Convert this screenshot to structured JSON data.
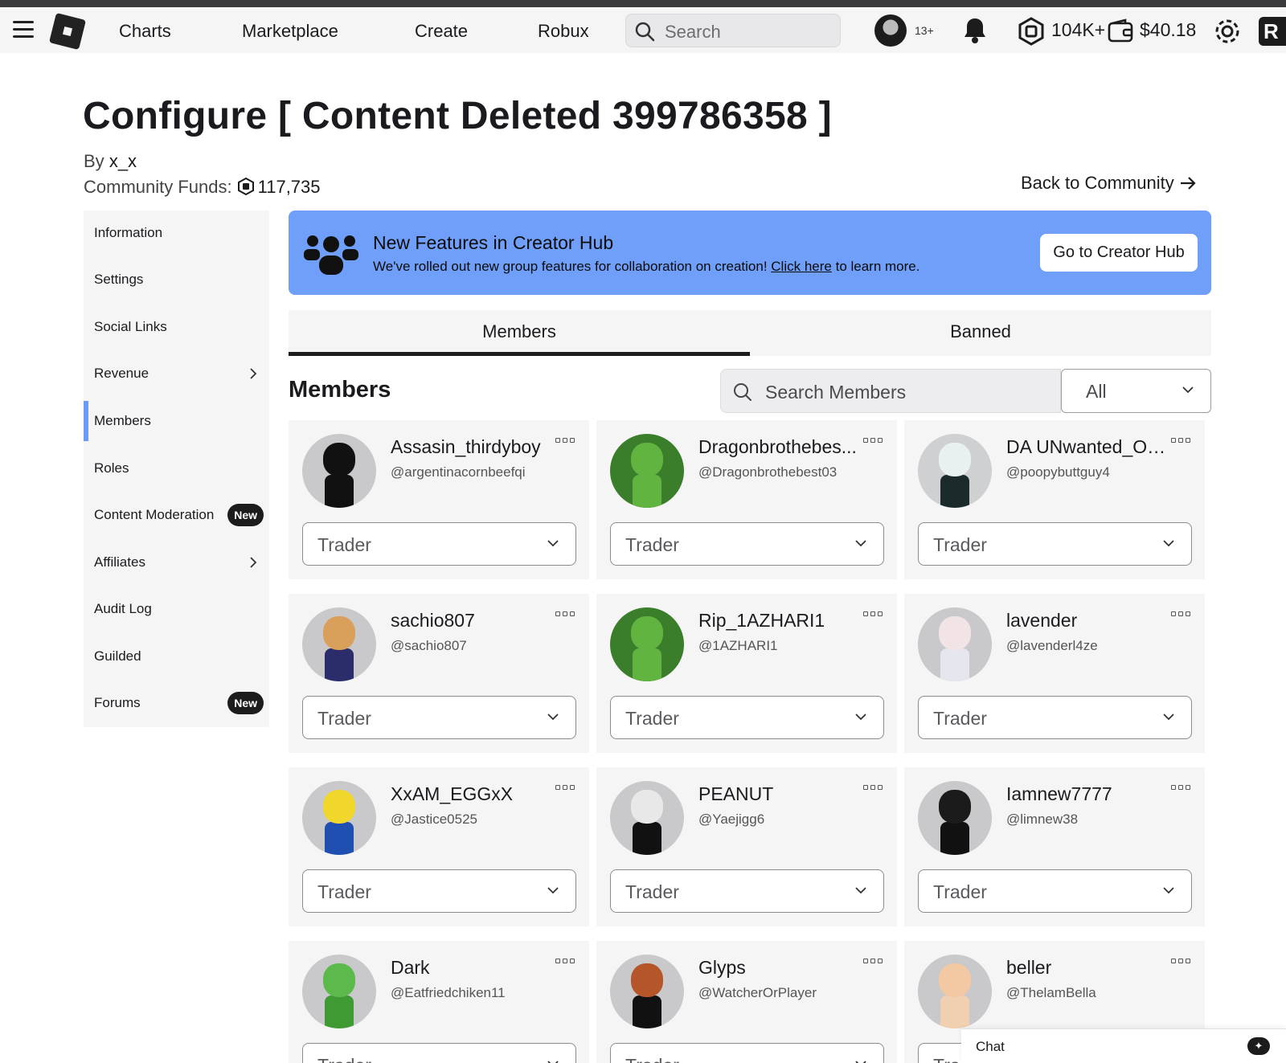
{
  "topnav": {
    "links": [
      "Charts",
      "Marketplace",
      "Create",
      "Robux"
    ],
    "search_placeholder": "Search",
    "age_badge": "13+",
    "robux_balance": "104K+",
    "wallet_balance": "$40.18",
    "partial_icon_letter": "R"
  },
  "header": {
    "title": "Configure [ Content Deleted 399786358 ]",
    "by_label": "By",
    "owner": "x_x",
    "funds_label": "Community Funds:",
    "funds_amount": "117,735",
    "back_link": "Back to Community"
  },
  "sidebar": {
    "items": [
      {
        "label": "Information"
      },
      {
        "label": "Settings"
      },
      {
        "label": "Social Links"
      },
      {
        "label": "Revenue"
      },
      {
        "label": "Members"
      },
      {
        "label": "Roles"
      },
      {
        "label": "Content Moderation",
        "badge": "New"
      },
      {
        "label": "Affiliates"
      },
      {
        "label": "Audit Log"
      },
      {
        "label": "Guilded"
      },
      {
        "label": "Forums",
        "badge": "New"
      }
    ],
    "active": "Members"
  },
  "banner": {
    "title": "New Features in Creator Hub",
    "desc_before": "We've rolled out new group features for collaboration on creation! ",
    "desc_link": "Click here",
    "desc_after": " to learn more.",
    "button": "Go to Creator Hub"
  },
  "tabs": [
    {
      "label": "Members",
      "active": true
    },
    {
      "label": "Banned",
      "active": false
    }
  ],
  "members": {
    "heading": "Members",
    "search_placeholder": "Search Members",
    "filter_value": "All",
    "cards": [
      {
        "name": "Assasin_thirdyboy",
        "handle": "@argentinacornbeefqi",
        "role": "Trader"
      },
      {
        "name": "Dragonbrothebes...",
        "handle": "@Dragonbrothebest03",
        "role": "Trader"
      },
      {
        "name": "DA UNwanted_One",
        "handle": "@poopybuttguy4",
        "role": "Trader"
      },
      {
        "name": "sachio807",
        "handle": "@sachio807",
        "role": "Trader"
      },
      {
        "name": "Rip_1AZHARI1",
        "handle": "@1AZHARI1",
        "role": "Trader"
      },
      {
        "name": "lavender",
        "handle": "@lavenderl4ze",
        "role": "Trader"
      },
      {
        "name": "XxAM_EGGxX",
        "handle": "@Jastice0525",
        "role": "Trader"
      },
      {
        "name": "PEANUT",
        "handle": "@Yaejigg6",
        "role": "Trader"
      },
      {
        "name": "Iamnew7777",
        "handle": "@limnew38",
        "role": "Trader"
      },
      {
        "name": "Dark",
        "handle": "@Eatfriedchiken11",
        "role": "Trader"
      },
      {
        "name": "Glyps",
        "handle": "@WatcherOrPlayer",
        "role": "Trader"
      },
      {
        "name": "beller",
        "handle": "@ThelamBella",
        "role": "Trader"
      }
    ]
  },
  "chat": {
    "label": "Chat"
  },
  "colors": {
    "accent_blue": "#6f9ff8",
    "active_indicator": "#6b9bf7",
    "panel_bg": "#f5f5f6",
    "badge_bg": "#1c1c1c"
  }
}
